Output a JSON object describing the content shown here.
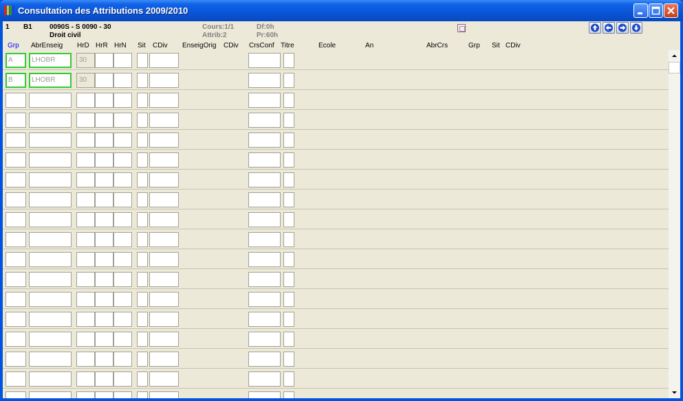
{
  "window": {
    "title": "Consultation des Attributions 2009/2010",
    "icon": "app-color-bars-icon",
    "controls": [
      "minimize-icon",
      "maximize-icon",
      "close-icon"
    ]
  },
  "header": {
    "line_no": "1",
    "code": "B1",
    "course": "0090S -   S 0090 - 30",
    "subject": "Droit civil",
    "cours": "Cours:1/1",
    "attrib": "Attrib:2",
    "df": "Df:0h",
    "pr": "Pr:60h"
  },
  "nav_buttons": [
    "arrow-up-icon",
    "arrow-left-icon",
    "arrow-right-icon",
    "arrow-down-icon"
  ],
  "columns": {
    "grp": "Grp",
    "abr_enseig": "AbrEnseig",
    "hrd": "HrD",
    "hrr": "HrR",
    "hrn": "HrN",
    "sit": "Sit",
    "cdiv": "CDiv",
    "enseig_orig": "EnseigOrig",
    "cdiv2": "CDiv",
    "crs_conf": "CrsConf",
    "titre": "Titre",
    "ecole": "Ecole",
    "an": "An",
    "abr_crs": "AbrCrs",
    "grp2": "Grp",
    "sit2": "Sit",
    "cdiv3": "CDiv"
  },
  "colors": {
    "title_bar": "#0a55d6",
    "client_bg": "#ece9d8",
    "highlight_border": "#34c934",
    "grp_header": "#0000ff"
  },
  "rows": [
    {
      "grp": "A",
      "abr_enseig": "LHOBR",
      "hrd": "30",
      "hrr": "",
      "hrn": "",
      "sit": "",
      "cdiv": "",
      "crs_conf": "",
      "titre": ""
    },
    {
      "grp": "B",
      "abr_enseig": "LHOBR",
      "hrd": "30",
      "hrr": "",
      "hrn": "",
      "sit": "",
      "cdiv": "",
      "crs_conf": "",
      "titre": ""
    },
    {
      "grp": "",
      "abr_enseig": "",
      "hrd": "",
      "hrr": "",
      "hrn": "",
      "sit": "",
      "cdiv": "",
      "crs_conf": "",
      "titre": ""
    },
    {
      "grp": "",
      "abr_enseig": "",
      "hrd": "",
      "hrr": "",
      "hrn": "",
      "sit": "",
      "cdiv": "",
      "crs_conf": "",
      "titre": ""
    },
    {
      "grp": "",
      "abr_enseig": "",
      "hrd": "",
      "hrr": "",
      "hrn": "",
      "sit": "",
      "cdiv": "",
      "crs_conf": "",
      "titre": ""
    },
    {
      "grp": "",
      "abr_enseig": "",
      "hrd": "",
      "hrr": "",
      "hrn": "",
      "sit": "",
      "cdiv": "",
      "crs_conf": "",
      "titre": ""
    },
    {
      "grp": "",
      "abr_enseig": "",
      "hrd": "",
      "hrr": "",
      "hrn": "",
      "sit": "",
      "cdiv": "",
      "crs_conf": "",
      "titre": ""
    },
    {
      "grp": "",
      "abr_enseig": "",
      "hrd": "",
      "hrr": "",
      "hrn": "",
      "sit": "",
      "cdiv": "",
      "crs_conf": "",
      "titre": ""
    },
    {
      "grp": "",
      "abr_enseig": "",
      "hrd": "",
      "hrr": "",
      "hrn": "",
      "sit": "",
      "cdiv": "",
      "crs_conf": "",
      "titre": ""
    },
    {
      "grp": "",
      "abr_enseig": "",
      "hrd": "",
      "hrr": "",
      "hrn": "",
      "sit": "",
      "cdiv": "",
      "crs_conf": "",
      "titre": ""
    },
    {
      "grp": "",
      "abr_enseig": "",
      "hrd": "",
      "hrr": "",
      "hrn": "",
      "sit": "",
      "cdiv": "",
      "crs_conf": "",
      "titre": ""
    },
    {
      "grp": "",
      "abr_enseig": "",
      "hrd": "",
      "hrr": "",
      "hrn": "",
      "sit": "",
      "cdiv": "",
      "crs_conf": "",
      "titre": ""
    },
    {
      "grp": "",
      "abr_enseig": "",
      "hrd": "",
      "hrr": "",
      "hrn": "",
      "sit": "",
      "cdiv": "",
      "crs_conf": "",
      "titre": ""
    },
    {
      "grp": "",
      "abr_enseig": "",
      "hrd": "",
      "hrr": "",
      "hrn": "",
      "sit": "",
      "cdiv": "",
      "crs_conf": "",
      "titre": ""
    },
    {
      "grp": "",
      "abr_enseig": "",
      "hrd": "",
      "hrr": "",
      "hrn": "",
      "sit": "",
      "cdiv": "",
      "crs_conf": "",
      "titre": ""
    },
    {
      "grp": "",
      "abr_enseig": "",
      "hrd": "",
      "hrr": "",
      "hrn": "",
      "sit": "",
      "cdiv": "",
      "crs_conf": "",
      "titre": ""
    },
    {
      "grp": "",
      "abr_enseig": "",
      "hrd": "",
      "hrr": "",
      "hrn": "",
      "sit": "",
      "cdiv": "",
      "crs_conf": "",
      "titre": ""
    },
    {
      "grp": "",
      "abr_enseig": "",
      "hrd": "",
      "hrr": "",
      "hrn": "",
      "sit": "",
      "cdiv": "",
      "crs_conf": "",
      "titre": ""
    }
  ]
}
